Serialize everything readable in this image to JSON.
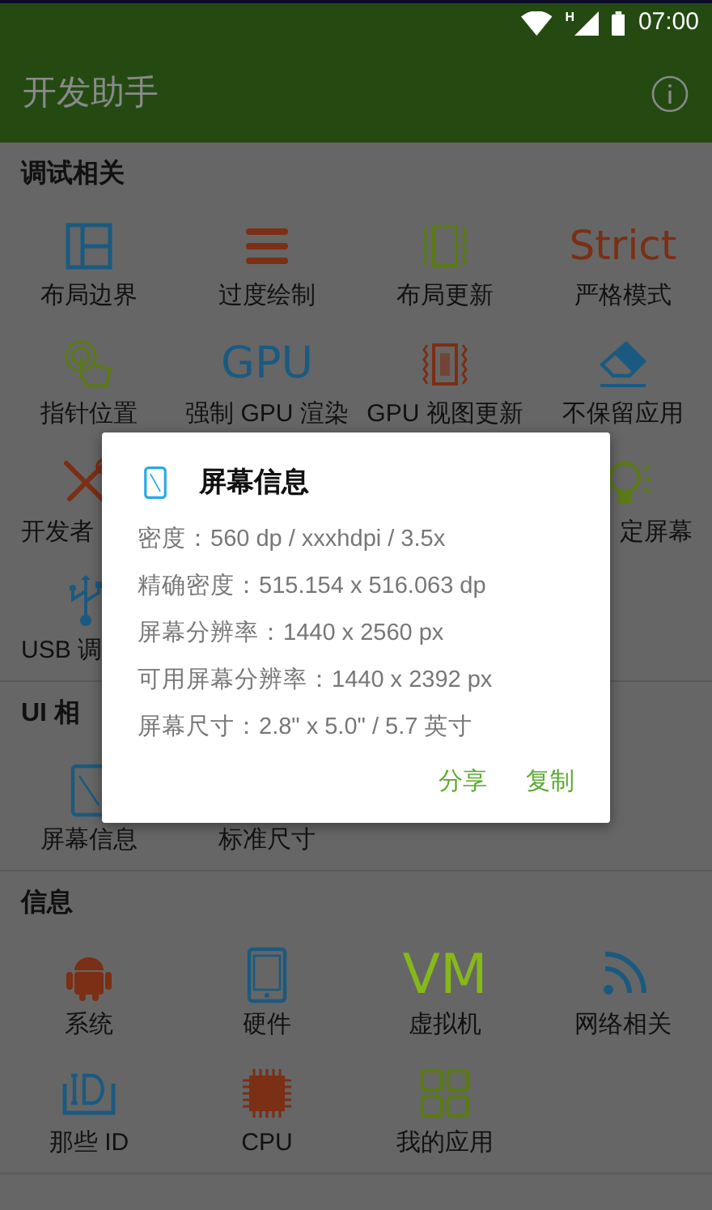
{
  "status_bar": {
    "network": "H",
    "time": "07:00"
  },
  "app_bar": {
    "title": "开发助手"
  },
  "sections": [
    {
      "title": "调试相关",
      "items": [
        {
          "kind": "tile",
          "label": "布局边界"
        },
        {
          "kind": "tile",
          "label": "过度绘制"
        },
        {
          "kind": "tile",
          "label": "布局更新"
        },
        {
          "kind": "tile",
          "label": "严格模式",
          "icon_text": "Strict"
        },
        {
          "kind": "tile",
          "label": "指针位置"
        },
        {
          "kind": "tile",
          "label": "强制 GPU 渲染",
          "icon_text": "GPU"
        },
        {
          "kind": "tile",
          "label": "GPU 视图更新"
        },
        {
          "kind": "tile",
          "label": "不保留应用"
        },
        {
          "kind": "tail-hidden",
          "label": "开发者"
        },
        {
          "kind": "head-hidden",
          "label": "定屏幕"
        },
        {
          "kind": "tail-hidden",
          "label": "USB 调"
        }
      ]
    },
    {
      "title": "UI 相",
      "items": [
        {
          "label": "屏幕信息"
        },
        {
          "label": "标准尺寸"
        }
      ]
    },
    {
      "title": "信息",
      "items": [
        {
          "label": "系统"
        },
        {
          "label": "硬件"
        },
        {
          "label": "虚拟机",
          "icon_text": "VM"
        },
        {
          "label": "网络相关"
        },
        {
          "label": "那些 ID"
        },
        {
          "label": "CPU"
        },
        {
          "label": "我的应用"
        }
      ]
    }
  ],
  "dialog": {
    "title": "屏幕信息",
    "lines": [
      "密度：560 dp / xxxhdpi / 3.5x",
      "精确密度：515.154 x 516.063 dp",
      "屏幕分辨率：1440 x 2560 px",
      "可用屏幕分辨率：1440 x 2392 px",
      "屏幕尺寸：2.8\" x 5.0\" / 5.7 英寸"
    ],
    "buttons": [
      "分享",
      "复制"
    ]
  }
}
